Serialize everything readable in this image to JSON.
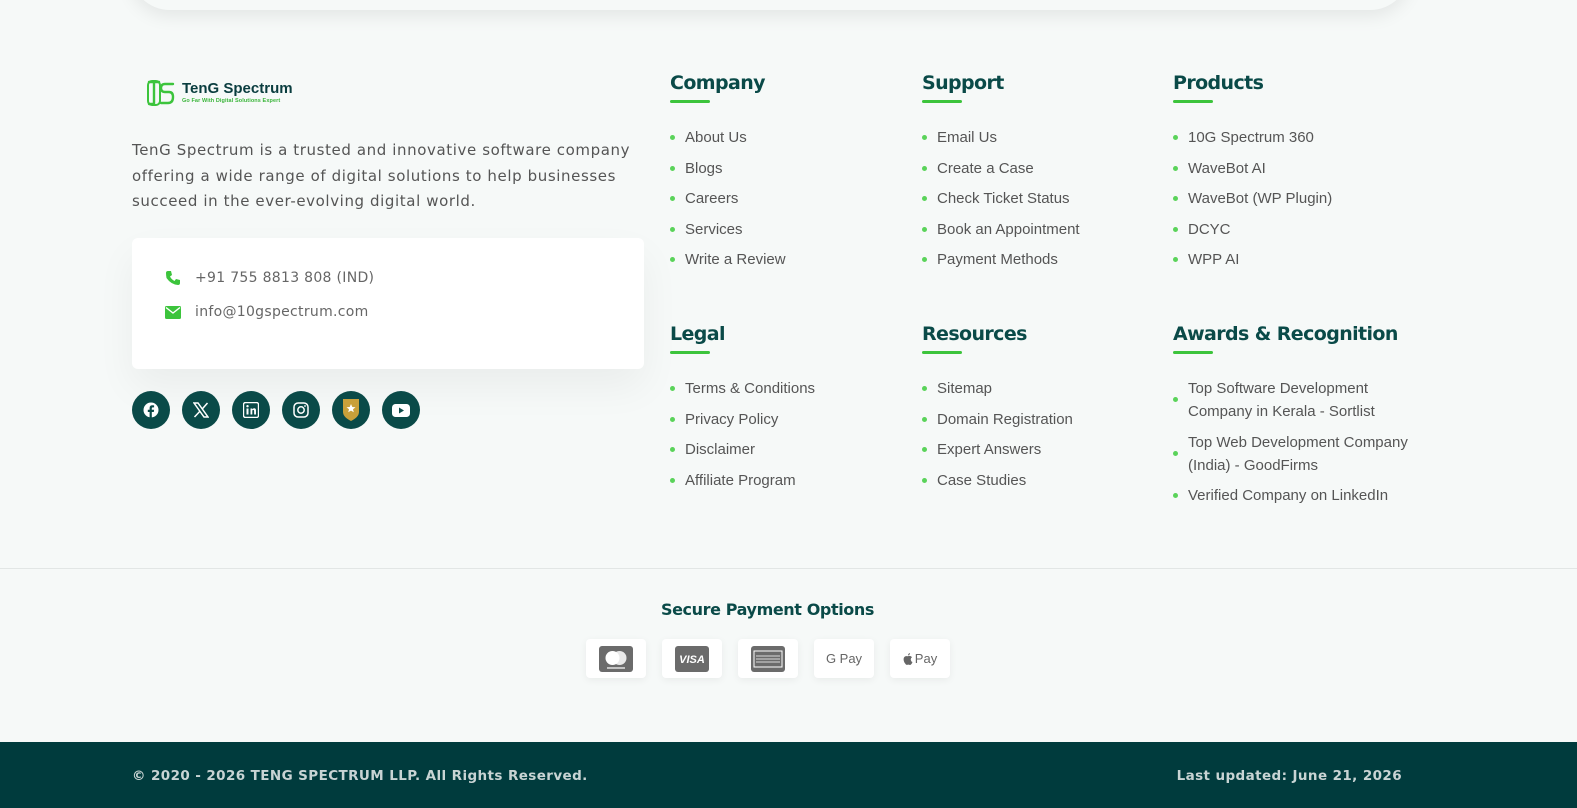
{
  "brand": {
    "name": "TenG Spectrum",
    "tagline": "Go Far With Digital Solutions Expert",
    "about": "TenG Spectrum is a trusted and innovative software company offering a wide range of digital solutions to help businesses succeed in the ever-evolving digital world."
  },
  "contact": {
    "phone": "+91 755 8813 808 (IND)",
    "email": "info@10gspectrum.com"
  },
  "socials": [
    "facebook-icon",
    "x-icon",
    "linkedin-icon",
    "instagram-icon",
    "award-badge-icon",
    "youtube-icon"
  ],
  "columns": {
    "company": {
      "title": "Company",
      "items": [
        "About Us",
        "Blogs",
        "Careers",
        "Services",
        "Write a Review"
      ]
    },
    "support": {
      "title": "Support",
      "items": [
        "Email Us",
        "Create a Case",
        "Check Ticket Status",
        "Book an Appointment",
        "Payment Methods"
      ]
    },
    "products": {
      "title": "Products",
      "items": [
        "10G Spectrum 360",
        "WaveBot AI",
        "WaveBot (WP Plugin)",
        "DCYC",
        "WPP AI"
      ]
    },
    "legal": {
      "title": "Legal",
      "items": [
        "Terms & Conditions",
        "Privacy Policy",
        "Disclaimer",
        "Affiliate Program"
      ]
    },
    "resources": {
      "title": "Resources",
      "items": [
        "Sitemap",
        "Domain Registration",
        "Expert Answers",
        "Case Studies"
      ]
    },
    "awards": {
      "title": "Awards & Recognition",
      "items": [
        "Top Software Development Company in Kerala - Sortlist",
        "Top Web Development Company (India) - GoodFirms",
        "Verified Company on LinkedIn"
      ]
    }
  },
  "payments": {
    "title": "Secure Payment Options",
    "cards": [
      "mastercard-icon",
      "visa-icon",
      "amex-icon",
      "G Pay",
      "Pay"
    ]
  },
  "footer": {
    "copyright": "© 2020 - 2026 TENG SPECTRUM LLP. All Rights Reserved.",
    "updated": "Last updated: June 21, 2026"
  },
  "colors": {
    "primary": "#0a4a48",
    "accent": "#3cc43c",
    "bottom_bar": "#003b3d"
  }
}
